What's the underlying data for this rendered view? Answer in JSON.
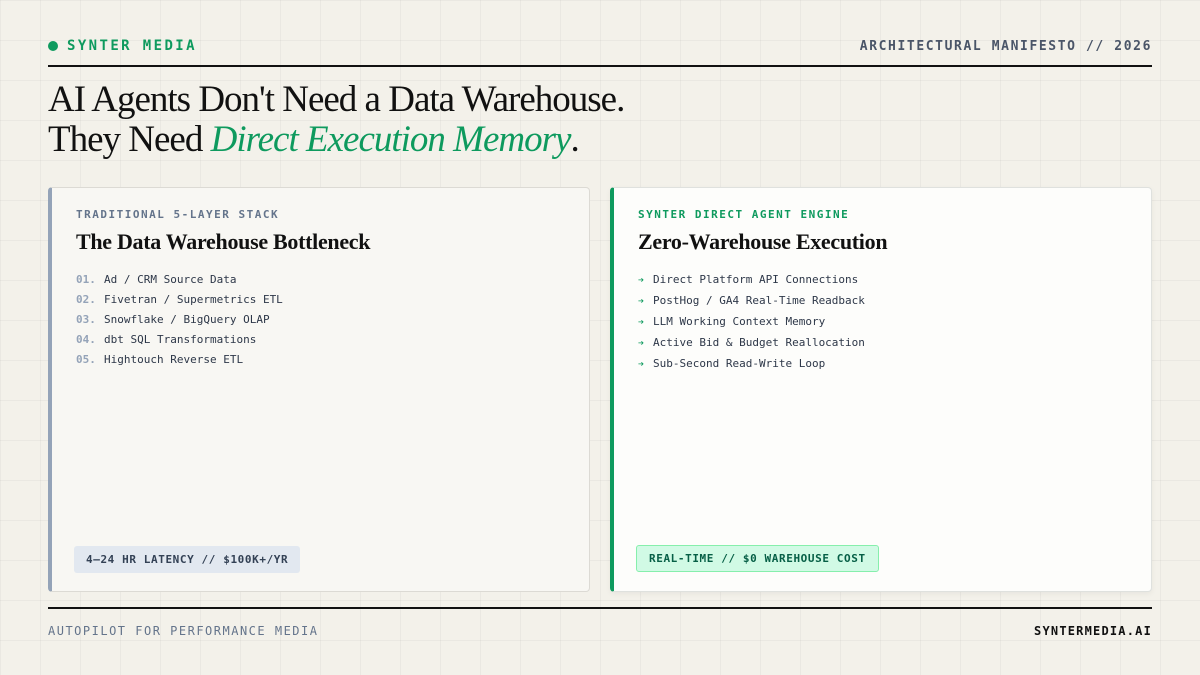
{
  "colors": {
    "accent": "#0e9a5e",
    "slate": "#94a3b8",
    "ink": "#111111"
  },
  "header": {
    "brand": "SYNTER MEDIA",
    "brand_icon": "dot-icon",
    "manifesto": "ARCHITECTURAL MANIFESTO // 2026"
  },
  "headline": {
    "line1": "AI Agents Don't Need a Data Warehouse.",
    "line2_prefix": "They Need ",
    "line2_accent": "Direct Execution Memory",
    "line2_suffix": "."
  },
  "left_card": {
    "kicker": "TRADITIONAL 5-LAYER STACK",
    "title": "The Data Warehouse Bottleneck",
    "items": [
      {
        "num": "01.",
        "text": "Ad / CRM Source Data"
      },
      {
        "num": "02.",
        "text": "Fivetran / Supermetrics ETL"
      },
      {
        "num": "03.",
        "text": "Snowflake / BigQuery OLAP"
      },
      {
        "num": "04.",
        "text": "dbt SQL Transformations"
      },
      {
        "num": "05.",
        "text": "Hightouch Reverse ETL"
      }
    ],
    "badge": "4–24 HR LATENCY // $100K+/YR"
  },
  "right_card": {
    "kicker": "SYNTER DIRECT AGENT ENGINE",
    "title": "Zero-Warehouse Execution",
    "bullet_icon": "arrow-right-icon",
    "items": [
      {
        "arrow": "➔",
        "text": "Direct Platform API Connections"
      },
      {
        "arrow": "➔",
        "text": "PostHog / GA4 Real-Time Readback"
      },
      {
        "arrow": "➔",
        "text": "LLM Working Context Memory"
      },
      {
        "arrow": "➔",
        "text": "Active Bid & Budget Reallocation"
      },
      {
        "arrow": "➔",
        "text": "Sub-Second Read-Write Loop"
      }
    ],
    "badge": "REAL-TIME // $0 WAREHOUSE COST"
  },
  "footer": {
    "tagline": "AUTOPILOT FOR PERFORMANCE MEDIA",
    "domain": "SYNTERMEDIA.AI"
  }
}
